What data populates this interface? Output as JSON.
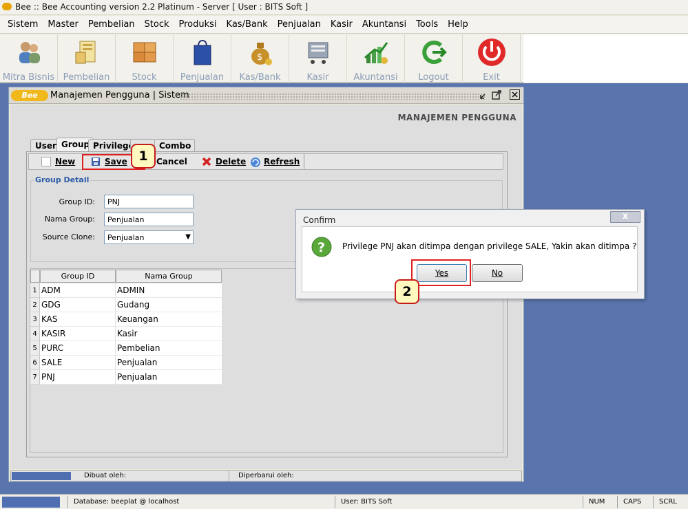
{
  "window_title": "Bee :: Bee Accounting version 2.2 Platinum - Server  [ User : BITS Soft ]",
  "menu": [
    "Sistem",
    "Master",
    "Pembelian",
    "Stock",
    "Produksi",
    "Kas/Bank",
    "Penjualan",
    "Kasir",
    "Akuntansi",
    "Tools",
    "Help"
  ],
  "toolbar": {
    "mitra": "Mitra Bisnis",
    "pembelian": "Pembelian",
    "stock": "Stock",
    "penjualan": "Penjualan",
    "kasbank": "Kas/Bank",
    "kasir": "Kasir",
    "akuntansi": "Akuntansi",
    "logout": "Logout",
    "exit": "Exit"
  },
  "inner_window": {
    "title": "Manajemen Pengguna | Sistem",
    "heading": "MANAJEMEN PENGGUNA",
    "logo_text": "Bee"
  },
  "tabs": {
    "user": "User",
    "group": "Group",
    "privilege": "Privilege",
    "hidden": "...",
    "combo": "Combo"
  },
  "actions": {
    "new": "New",
    "save": "Save",
    "cancel": "Cancel",
    "delete": "Delete",
    "refresh": "Refresh"
  },
  "group_detail": {
    "legend": "Group Detail",
    "group_id_label": "Group ID:",
    "group_id_value": "PNJ",
    "nama_group_label": "Nama Group:",
    "nama_group_value": "Penjualan",
    "source_clone_label": "Source Clone:",
    "source_clone_value": "Penjualan"
  },
  "grid": {
    "headers": [
      "Group ID",
      "Nama Group"
    ],
    "rows": [
      {
        "n": "1",
        "id": "ADM",
        "name": "ADMIN"
      },
      {
        "n": "2",
        "id": "GDG",
        "name": "Gudang"
      },
      {
        "n": "3",
        "id": "KAS",
        "name": "Keuangan"
      },
      {
        "n": "4",
        "id": "KASIR",
        "name": "Kasir"
      },
      {
        "n": "5",
        "id": "PURC",
        "name": "Pembelian"
      },
      {
        "n": "6",
        "id": "SALE",
        "name": "Penjualan"
      },
      {
        "n": "7",
        "id": "PNJ",
        "name": "Penjualan"
      }
    ]
  },
  "inner_status": {
    "created": "Dibuat oleh:",
    "updated": "Diperbarui oleh:"
  },
  "confirm": {
    "title": "Confirm",
    "message": "Privilege PNJ akan ditimpa dengan privilege SALE, Yakin akan ditimpa ?",
    "yes": "Yes",
    "no": "No",
    "close": "x"
  },
  "badges": {
    "one": "1",
    "two": "2"
  },
  "statusbar": {
    "database": "Database: beeplat @ localhost",
    "user": "User: BITS Soft",
    "num": "NUM",
    "caps": "CAPS",
    "scrl": "SCRL"
  },
  "colors": {
    "desktop": "#5a74ad",
    "highlight": "#e02020",
    "badge_fill": "#fff9c0",
    "legend": "#2a5aa8"
  }
}
